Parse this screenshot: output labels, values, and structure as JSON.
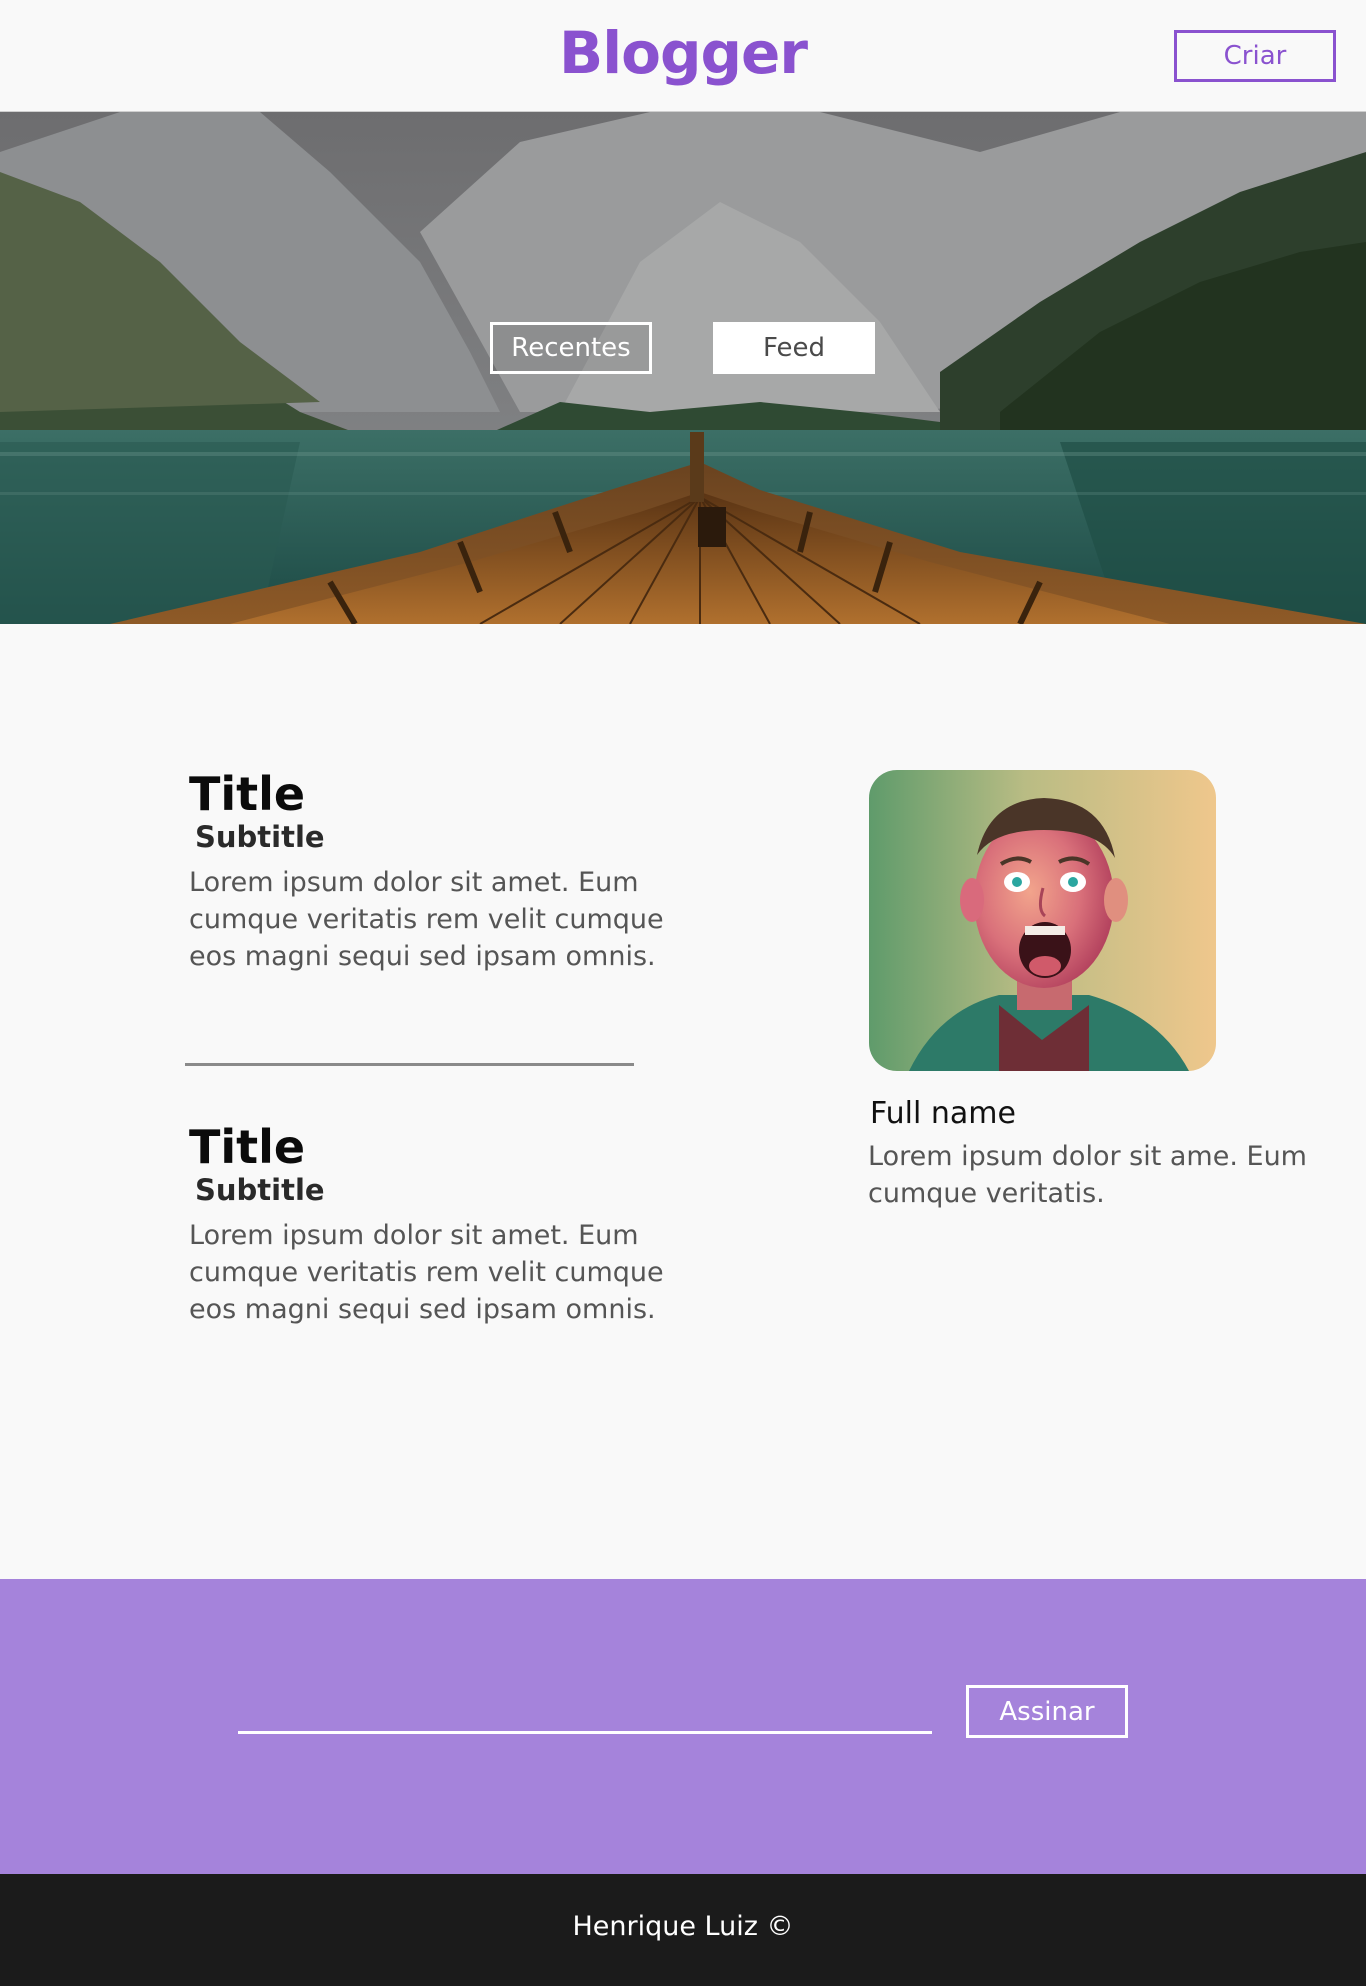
{
  "colors": {
    "brand": "#8a52cf",
    "subscribe_band": "#a583db",
    "footer_bg": "#1b1b1b",
    "page_bg": "#f9f9f9"
  },
  "header": {
    "logo": "Blogger",
    "create_button": "Criar"
  },
  "hero": {
    "image": "mountain-lake-boat-photo",
    "tabs": [
      {
        "label": "Recentes"
      },
      {
        "label": "Feed"
      }
    ]
  },
  "posts": [
    {
      "title": "Title",
      "subtitle": "Subtitle",
      "body": "Lorem ipsum dolor sit amet. Eum cumque veritatis rem velit cumque eos magni sequi sed ipsam omnis."
    },
    {
      "title": "Title",
      "subtitle": "Subtitle",
      "body": "Lorem ipsum dolor sit amet. Eum cumque veritatis rem velit cumque eos magni sequi sed ipsam omnis."
    }
  ],
  "profile": {
    "photo": "profile-photo",
    "name": "Full name",
    "description": "Lorem ipsum dolor sit ame. Eum cumque veritatis."
  },
  "subscribe": {
    "email_value": "",
    "button": "Assinar"
  },
  "footer": {
    "text": "Henrique Luiz ©"
  }
}
